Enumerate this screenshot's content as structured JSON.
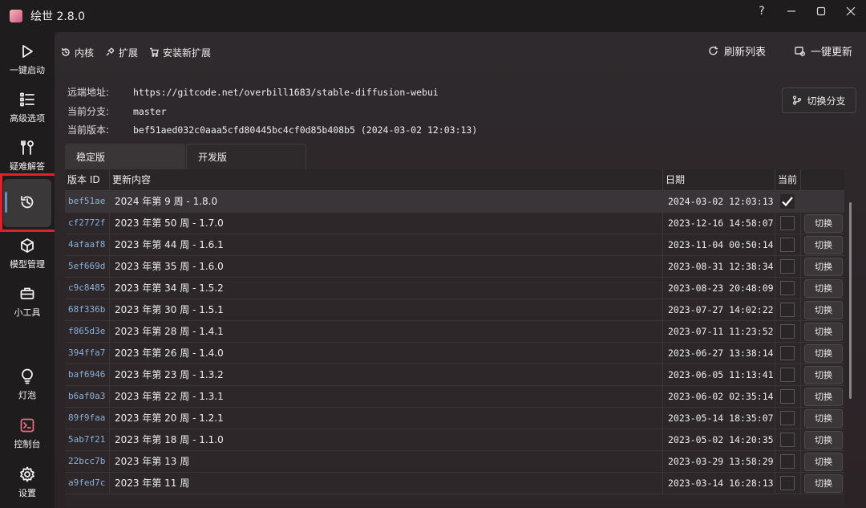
{
  "app": {
    "title": "绘世 2.8.0"
  },
  "window_controls": {
    "help": "?"
  },
  "sidebar": {
    "items": [
      {
        "label": "一键启动",
        "icon": "play-icon"
      },
      {
        "label": "高级选项",
        "icon": "list-icon"
      },
      {
        "label": "疑难解答",
        "icon": "tools-icon"
      },
      {
        "label": "",
        "icon": "history-icon"
      },
      {
        "label": "模型管理",
        "icon": "cube-icon"
      },
      {
        "label": "小工具",
        "icon": "toolbox-icon"
      },
      {
        "label": "灯泡",
        "icon": "bulb-icon"
      },
      {
        "label": "控制台",
        "icon": "console-icon"
      },
      {
        "label": "设置",
        "icon": "gear-icon"
      }
    ]
  },
  "topbar": {
    "tabs": [
      {
        "label": "内核",
        "icon": "history-icon"
      },
      {
        "label": "扩展",
        "icon": "plugin-icon"
      },
      {
        "label": "安装新扩展",
        "icon": "cart-icon"
      }
    ],
    "refresh_label": "刷新列表",
    "update_label": "一键更新"
  },
  "info": {
    "remote_key": "远端地址:",
    "remote_value": "https://gitcode.net/overbill1683/stable-diffusion-webui",
    "branch_key": "当前分支:",
    "branch_value": "master",
    "version_key": "当前版本:",
    "version_value": "bef51aed032c0aaa5cfd80445bc4cf0d85b408b5 (2024-03-02 12:03:13)"
  },
  "switch_branch_label": "切换分支",
  "version_tabs": [
    "稳定版",
    "开发版"
  ],
  "table": {
    "headers": [
      "版本 ID",
      "更新内容",
      "日期",
      "当前"
    ],
    "switch_label": "切换",
    "rows": [
      {
        "id": "bef51ae",
        "msg": "2024 年第 9 周 - 1.8.0",
        "date": "2024-03-02 12:03:13",
        "current": true
      },
      {
        "id": "cf2772f",
        "msg": "2023 年第 50 周 - 1.7.0",
        "date": "2023-12-16 14:58:07",
        "current": false
      },
      {
        "id": "4afaaf8",
        "msg": "2023 年第 44 周 - 1.6.1",
        "date": "2023-11-04 00:50:14",
        "current": false
      },
      {
        "id": "5ef669d",
        "msg": "2023 年第 35 周 - 1.6.0",
        "date": "2023-08-31 12:38:34",
        "current": false
      },
      {
        "id": "c9c8485",
        "msg": "2023 年第 34 周 - 1.5.2",
        "date": "2023-08-23 20:48:09",
        "current": false
      },
      {
        "id": "68f336b",
        "msg": "2023 年第 30 周 - 1.5.1",
        "date": "2023-07-27 14:02:22",
        "current": false
      },
      {
        "id": "f865d3e",
        "msg": "2023 年第 28 周 - 1.4.1",
        "date": "2023-07-11 11:23:52",
        "current": false
      },
      {
        "id": "394ffa7",
        "msg": "2023 年第 26 周 - 1.4.0",
        "date": "2023-06-27 13:38:14",
        "current": false
      },
      {
        "id": "baf6946",
        "msg": "2023 年第 23 周 - 1.3.2",
        "date": "2023-06-05 11:13:41",
        "current": false
      },
      {
        "id": "b6af0a3",
        "msg": "2023 年第 22 周 - 1.3.1",
        "date": "2023-06-02 02:35:14",
        "current": false
      },
      {
        "id": "89f9faa",
        "msg": "2023 年第 20 周 - 1.2.1",
        "date": "2023-05-14 18:35:07",
        "current": false
      },
      {
        "id": "5ab7f21",
        "msg": "2023 年第 18 周 - 1.1.0",
        "date": "2023-05-02 14:20:35",
        "current": false
      },
      {
        "id": "22bcc7b",
        "msg": "2023 年第 13 周",
        "date": "2023-03-29 13:58:29",
        "current": false
      },
      {
        "id": "a9fed7c",
        "msg": "2023 年第 11 周",
        "date": "2023-03-14 16:28:13",
        "current": false
      }
    ]
  }
}
